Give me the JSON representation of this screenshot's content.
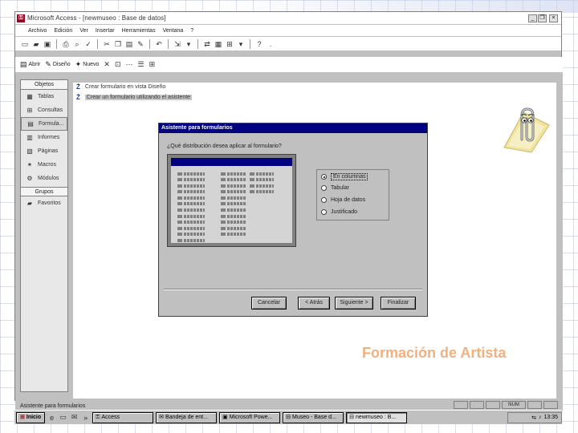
{
  "window": {
    "title": "Microsoft Access - [newmuseo : Base de datos]",
    "min": "_",
    "restore": "❐",
    "close": "×"
  },
  "menu": {
    "items": [
      "Archivo",
      "Edición",
      "Ver",
      "Insertar",
      "Herramientas",
      "Ventana",
      "?"
    ]
  },
  "db_toolbar": {
    "open": "Abrir",
    "design": "Diseño",
    "new": "Nuevo"
  },
  "sidebar": {
    "objects_header": "Objetos",
    "items": [
      "Tablas",
      "Consultas",
      "Formula...",
      "Informes",
      "Páginas",
      "Macros",
      "Módulos"
    ],
    "groups_header": "Grupos",
    "favorites": "Favoritos"
  },
  "list": {
    "items": [
      "Crear formulario en vista Diseño",
      "Crear un formulario utilizando el asistente"
    ]
  },
  "wizard": {
    "title": "Asistente para formularios",
    "question": "¿Qué distribución desea aplicar al formulario?",
    "options": [
      "En columnas",
      "Tabular",
      "Hoja de datos",
      "Justificado"
    ],
    "selected_option": "En columnas",
    "buttons": {
      "cancel": "Cancelar",
      "back": "< Atrás",
      "next": "Siguiente >",
      "finish": "Finalizar"
    }
  },
  "watermark": "Formación de Artista",
  "status": {
    "text": "Asistente para formularios",
    "num": "NUM"
  },
  "taskbar": {
    "start": "Inicio",
    "tasks": [
      "Access",
      "Bandeja de ent...",
      "Microsoft Powe...",
      "Museo - Base d...",
      "newmuseo : B..."
    ],
    "clock": "13:35"
  },
  "colors": {
    "dialog_title": "#000080",
    "face": "#c0c0c0",
    "watermark": "#f0b080"
  }
}
